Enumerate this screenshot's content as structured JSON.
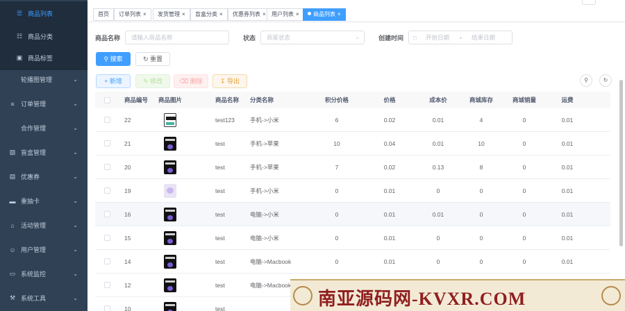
{
  "sidebar": {
    "items": [
      {
        "label": "商品列表",
        "icon": "list-icon",
        "sub": true,
        "active": true
      },
      {
        "label": "商品分类",
        "icon": "tree-icon",
        "sub": true
      },
      {
        "label": "商品标签",
        "icon": "tag-icon",
        "sub": true
      },
      {
        "label": "轮播图管理",
        "icon": "",
        "sub": false,
        "expand": true
      },
      {
        "label": "订单管理",
        "icon": "order-icon",
        "sub": false,
        "expand": true
      },
      {
        "label": "合作管理",
        "icon": "",
        "sub": false,
        "expand": true
      },
      {
        "label": "盲盒管理",
        "icon": "box-icon",
        "sub": false,
        "expand": true
      },
      {
        "label": "优惠券",
        "icon": "coupon-icon",
        "sub": false,
        "expand": true
      },
      {
        "label": "重抽卡",
        "icon": "card-icon",
        "sub": false,
        "expand": true
      },
      {
        "label": "活动管理",
        "icon": "home-icon",
        "sub": false,
        "expand": true
      },
      {
        "label": "用户管理",
        "icon": "user-icon",
        "sub": false,
        "expand": true
      },
      {
        "label": "系统监控",
        "icon": "monitor-icon",
        "sub": false,
        "expand": true
      },
      {
        "label": "系统工具",
        "icon": "tool-icon",
        "sub": false,
        "expand": true
      }
    ]
  },
  "tags": [
    {
      "label": "首页",
      "closable": false
    },
    {
      "label": "订单列表",
      "closable": true
    },
    {
      "label": "发货管理",
      "closable": true
    },
    {
      "label": "盲盒分类",
      "closable": true
    },
    {
      "label": "优惠券列表",
      "closable": true
    },
    {
      "label": "用户列表",
      "closable": true
    },
    {
      "label": "商品列表",
      "closable": true,
      "active": true
    }
  ],
  "search": {
    "name_label": "商品名称",
    "name_placeholder": "请输入商品名称",
    "status_label": "状态",
    "status_placeholder": "商家状态",
    "time_label": "创建时间",
    "start_placeholder": "开始日期",
    "sep": "-",
    "end_placeholder": "结束日期",
    "search_btn": "搜索",
    "reset_btn": "重置"
  },
  "toolbar": {
    "add": "新增",
    "edit": "修改",
    "delete": "删除",
    "export": "导出"
  },
  "table": {
    "headers": [
      "商品编号",
      "商品图片",
      "商品名称",
      "分类名称",
      "积分价格",
      "价格",
      "成本价",
      "商城库存",
      "商城销量",
      "运费"
    ],
    "rows": [
      {
        "id": "22",
        "thumb": "first",
        "name": "test123",
        "category": "手机->小米",
        "points": "6",
        "price": "0.02",
        "cost": "0.01",
        "stock": "4",
        "sales": "0",
        "freight": "0.01"
      },
      {
        "id": "21",
        "thumb": "dark",
        "name": "test",
        "category": "手机->苹果",
        "points": "10",
        "price": "0.04",
        "cost": "0.01",
        "stock": "10",
        "sales": "0",
        "freight": "0.01"
      },
      {
        "id": "20",
        "thumb": "dark",
        "name": "test",
        "category": "手机->苹果",
        "points": "7",
        "price": "0.02",
        "cost": "0.13",
        "stock": "8",
        "sales": "0",
        "freight": "0.01"
      },
      {
        "id": "19",
        "thumb": "light",
        "name": "test",
        "category": "手机->小米",
        "points": "0",
        "price": "0.01",
        "cost": "0",
        "stock": "0",
        "sales": "0",
        "freight": "0.01"
      },
      {
        "id": "16",
        "thumb": "dark",
        "name": "test",
        "category": "电脑->小米",
        "points": "0",
        "price": "0.01",
        "cost": "0.01",
        "stock": "0",
        "sales": "0",
        "freight": "0.01"
      },
      {
        "id": "15",
        "thumb": "dark",
        "name": "test",
        "category": "电脑->小米",
        "points": "0",
        "price": "0.01",
        "cost": "0",
        "stock": "0",
        "sales": "0",
        "freight": "0.01"
      },
      {
        "id": "14",
        "thumb": "dark",
        "name": "test",
        "category": "电脑->Macbook",
        "points": "0",
        "price": "0.01",
        "cost": "0",
        "stock": "0",
        "sales": "0",
        "freight": "0.01"
      },
      {
        "id": "12",
        "thumb": "dark",
        "name": "test",
        "category": "电脑->Macbook",
        "points": "",
        "price": "",
        "cost": "",
        "stock": "",
        "sales": "",
        "freight": ""
      },
      {
        "id": "10",
        "thumb": "dark",
        "name": "test",
        "category": "",
        "points": "",
        "price": "",
        "cost": "",
        "stock": "",
        "sales": "",
        "freight": ""
      }
    ]
  },
  "watermark": {
    "text": "南亚源码网-KVXR.COM"
  },
  "colors": {
    "primary": "#409eff",
    "sidebar": "#304156"
  }
}
